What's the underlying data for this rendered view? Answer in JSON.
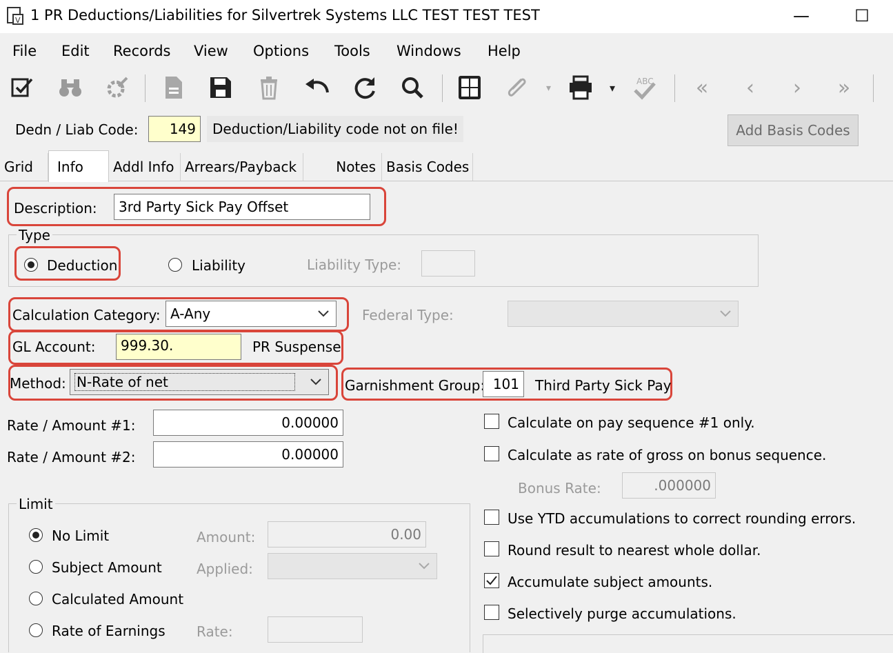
{
  "window": {
    "title": "1 PR Deductions/Liabilities for Silvertrek Systems LLC TEST TEST TEST",
    "minimize": "—",
    "maximize": "☐"
  },
  "menu": [
    "File",
    "Edit",
    "Records",
    "View",
    "Options",
    "Tools",
    "Windows",
    "Help"
  ],
  "toolbar_icons": [
    "checklist-icon",
    "binoculars-icon",
    "wizard-icon",
    "new-document-icon",
    "save-icon",
    "delete-icon",
    "undo-icon",
    "refresh-icon",
    "search-icon",
    "calculator-icon",
    "attach-icon",
    "print-icon",
    "spellcheck-icon",
    "first-record-icon",
    "previous-record-icon",
    "next-record-icon",
    "last-record-icon"
  ],
  "code": {
    "label": "Dedn / Liab Code:",
    "value": "149",
    "message": "Deduction/Liability code not on file!",
    "add_basis_button": "Add Basis Codes"
  },
  "tabs": [
    "Grid",
    "Info",
    "Addl Info",
    "Arrears/Payback",
    "Notes",
    "Basis Codes"
  ],
  "active_tab": "Info",
  "description": {
    "label": "Description:",
    "value": "3rd Party Sick Pay Offset"
  },
  "type": {
    "title": "Type",
    "deduction": "Deduction",
    "liability": "Liability",
    "liability_type_label": "Liability Type:",
    "selected": "Deduction"
  },
  "calc_category": {
    "label": "Calculation Category:",
    "value": "A-Any"
  },
  "federal_type": {
    "label": "Federal Type:",
    "value": ""
  },
  "gl_account": {
    "label": "GL Account:",
    "value": "999.30.",
    "name": "PR Suspense"
  },
  "method": {
    "label": "Method:",
    "value": "N-Rate of net"
  },
  "garnishment": {
    "label": "Garnishment Group:",
    "code": "101",
    "name": "Third Party Sick Pay"
  },
  "rate1": {
    "label": "Rate / Amount #1:",
    "value": "0.00000"
  },
  "rate2": {
    "label": "Rate / Amount #2:",
    "value": "0.00000"
  },
  "options": {
    "pay_seq1": {
      "label": "Calculate on pay sequence #1 only.",
      "checked": false
    },
    "rate_gross_bonus": {
      "label": "Calculate as rate of gross on bonus sequence.",
      "checked": false
    },
    "bonus_rate_label": "Bonus Rate:",
    "bonus_rate_value": ".000000",
    "ytd": {
      "label": "Use YTD accumulations to correct rounding errors.",
      "checked": false
    },
    "round": {
      "label": "Round result to nearest whole dollar.",
      "checked": false
    },
    "accumulate": {
      "label": "Accumulate subject amounts.",
      "checked": true
    },
    "purge": {
      "label": "Selectively purge accumulations.",
      "checked": false
    }
  },
  "limit": {
    "title": "Limit",
    "no_limit": "No Limit",
    "subject_amount": "Subject Amount",
    "calculated_amount": "Calculated Amount",
    "rate_of_earnings": "Rate of Earnings",
    "selected": "No Limit",
    "amount_label": "Amount:",
    "amount_value": "0.00",
    "applied_label": "Applied:",
    "rate_label": "Rate:"
  },
  "colors": {
    "highlight": "#d9453a",
    "required_field": "#ffffcc"
  }
}
